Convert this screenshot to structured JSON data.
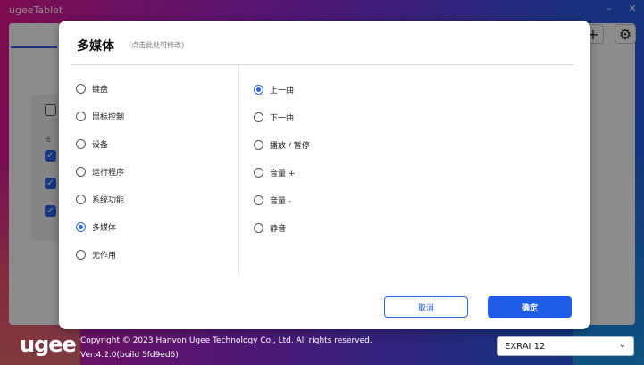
{
  "window": {
    "title": "ugeeTablet"
  },
  "dialog": {
    "title": "多媒体",
    "hint": "(点击此处可修改)",
    "categories": [
      {
        "label": "键盘",
        "selected": false
      },
      {
        "label": "鼠标控制",
        "selected": false
      },
      {
        "label": "设备",
        "selected": false
      },
      {
        "label": "运行程序",
        "selected": false
      },
      {
        "label": "系统功能",
        "selected": false
      },
      {
        "label": "多媒体",
        "selected": true
      },
      {
        "label": "无作用",
        "selected": false
      }
    ],
    "actions": [
      {
        "label": "上一曲",
        "selected": true
      },
      {
        "label": "下一曲",
        "selected": false
      },
      {
        "label": "播放 / 暂停",
        "selected": false
      },
      {
        "label": "音量 +",
        "selected": false
      },
      {
        "label": "音量 -",
        "selected": false
      },
      {
        "label": "静音",
        "selected": false
      }
    ],
    "cancel_label": "取消",
    "ok_label": "确定"
  },
  "background": {
    "tiny_label": "信"
  },
  "footer": {
    "logo": "ugee",
    "copyright": "Copyright © 2023 Hanvon Ugee Technology Co., Ltd. All rights reserved.",
    "version": "Ver:4.2.0(build 5fd9ed6)",
    "device": "EXRAI 12"
  },
  "colors": {
    "accent": "#2a63e8",
    "ok_button": "#1f5ce6"
  }
}
